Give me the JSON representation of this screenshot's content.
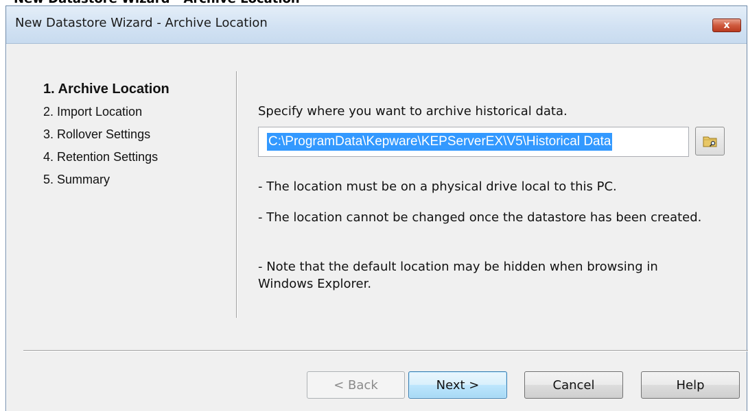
{
  "caption": "New Datastore Wizard - Archive Location",
  "window": {
    "title": "New Datastore Wizard - Archive Location",
    "close_glyph": "x"
  },
  "steps": [
    {
      "label": "1. Archive Location",
      "active": true
    },
    {
      "label": "2. Import Location",
      "active": false
    },
    {
      "label": "3. Rollover Settings",
      "active": false
    },
    {
      "label": "4. Retention Settings",
      "active": false
    },
    {
      "label": "5. Summary",
      "active": false
    }
  ],
  "main": {
    "prompt": "Specify where you want to archive historical data.",
    "path_value": "C:\\ProgramData\\Kepware\\KEPServerEX\\V5\\Historical Data",
    "browse_icon": "folder-search-icon",
    "notes": [
      "- The location must be on a physical drive local to this PC.",
      "- The location cannot be changed once the datastore has been created.",
      "- Note that the default location may be hidden when browsing in Windows Explorer."
    ]
  },
  "buttons": {
    "back": "< Back",
    "next": "Next >",
    "cancel": "Cancel",
    "help": "Help"
  },
  "colors": {
    "selection": "#3399ff",
    "close_button": "#c8472b",
    "default_button": "#bee6fd"
  }
}
